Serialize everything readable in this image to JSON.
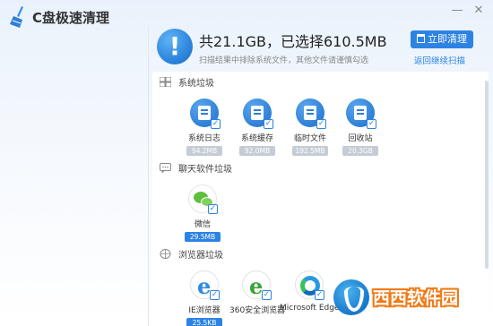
{
  "window": {
    "title": "C盘极速清理",
    "minimize_glyph": "—",
    "close_glyph": "✕"
  },
  "summary": {
    "headline": "共21.1GB，已选择610.5MB",
    "subtitle": "扫描结果中排除系统文件，其他文件请谨慎勾选",
    "status_icon": "exclamation-icon",
    "status_glyph": "!"
  },
  "actions": {
    "clean_now": "立即清理",
    "back_to_scan": "返回继续扫描"
  },
  "categories": [
    {
      "title": "系统垃圾",
      "icon": "windows-icon",
      "items": [
        {
          "label": "系统日志",
          "size": "94.2MB",
          "icon": "log-icon",
          "checked": true
        },
        {
          "label": "系统缓存",
          "size": "92.0MB",
          "icon": "cache-icon",
          "checked": true
        },
        {
          "label": "临时文件",
          "size": "192.5MB",
          "icon": "temp-file-icon",
          "checked": true
        },
        {
          "label": "回收站",
          "size": "20.3GB",
          "icon": "recycle-bin-icon",
          "checked": true
        }
      ]
    },
    {
      "title": "聊天软件垃圾",
      "icon": "chat-icon",
      "items": [
        {
          "label": "微信",
          "size": "29.5MB",
          "icon": "wechat-icon",
          "checked": true
        }
      ]
    },
    {
      "title": "浏览器垃圾",
      "icon": "browser-icon",
      "items": [
        {
          "label": "IE浏览器",
          "size": "25.5KB",
          "icon": "ie-icon",
          "checked": true
        },
        {
          "label": "360安全浏览器",
          "size": "",
          "icon": "360-browser-icon",
          "checked": true
        },
        {
          "label": "Microsoft Edge",
          "size": "",
          "icon": "edge-icon",
          "checked": true
        }
      ]
    }
  ],
  "checkmark_glyph": "✓",
  "watermark": {
    "text": "西西软件园"
  }
}
